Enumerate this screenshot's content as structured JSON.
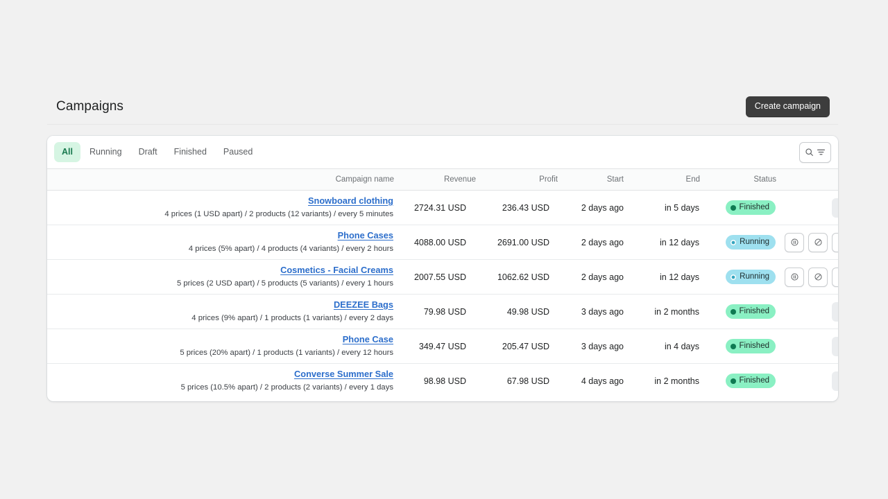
{
  "header": {
    "title": "Campaigns",
    "create_label": "Create campaign"
  },
  "filters": {
    "tabs": [
      {
        "label": "All",
        "active": true
      },
      {
        "label": "Running",
        "active": false
      },
      {
        "label": "Draft",
        "active": false
      },
      {
        "label": "Finished",
        "active": false
      },
      {
        "label": "Paused",
        "active": false
      }
    ],
    "search_icon": "search-icon",
    "filter_icon": "filter-icon"
  },
  "table": {
    "columns": [
      "Campaign name",
      "Revenue",
      "Profit",
      "Start",
      "End",
      "Status"
    ],
    "rows": [
      {
        "name": "Snowboard clothing",
        "details": "4 prices (1 USD apart) / 2 products (12 variants) / every 5 minutes",
        "revenue": "2724.31 USD",
        "profit": "236.43 USD",
        "start": "2 days ago",
        "end": "in 5 days",
        "status": "Finished",
        "status_type": "finished",
        "actions": [
          "view-disabled"
        ]
      },
      {
        "name": "Phone Cases",
        "details": "4 prices (5% apart) / 4 products (4 variants) / every 2 hours",
        "revenue": "4088.00 USD",
        "profit": "2691.00 USD",
        "start": "2 days ago",
        "end": "in 12 days",
        "status": "Running",
        "status_type": "running",
        "actions": [
          "pause",
          "stop",
          "view"
        ]
      },
      {
        "name": "Cosmetics - Facial Creams",
        "details": "5 prices (2 USD apart) / 5 products (5 variants) / every 1 hours",
        "revenue": "2007.55 USD",
        "profit": "1062.62 USD",
        "start": "2 days ago",
        "end": "in 12 days",
        "status": "Running",
        "status_type": "running",
        "actions": [
          "pause",
          "stop",
          "view"
        ]
      },
      {
        "name": "DEEZEE Bags",
        "details": "4 prices (9% apart) / 1 products (1 variants) / every 2 days",
        "revenue": "79.98 USD",
        "profit": "49.98 USD",
        "start": "3 days ago",
        "end": "in 2 months",
        "status": "Finished",
        "status_type": "finished",
        "actions": [
          "view-disabled"
        ]
      },
      {
        "name": "Phone Case",
        "details": "5 prices (20% apart) / 1 products (1 variants) / every 12 hours",
        "revenue": "349.47 USD",
        "profit": "205.47 USD",
        "start": "3 days ago",
        "end": "in 4 days",
        "status": "Finished",
        "status_type": "finished",
        "actions": [
          "view-disabled"
        ]
      },
      {
        "name": "Converse Summer Sale",
        "details": "5 prices (10.5% apart) / 2 products (2 variants) / every 1 days",
        "revenue": "98.98 USD",
        "profit": "67.98 USD",
        "start": "4 days ago",
        "end": "in 2 months",
        "status": "Finished",
        "status_type": "finished",
        "actions": [
          "view-disabled"
        ]
      }
    ]
  },
  "colors": {
    "page_background": "#f1f1f1",
    "card_background": "#ffffff",
    "link": "#2c6ecb",
    "primary_button": "#3d3d3d",
    "tab_active_bg": "#d6f5e3",
    "tab_active_text": "#18794e",
    "badge_finished": "#8af0c3",
    "badge_running": "#9ee0ef"
  }
}
